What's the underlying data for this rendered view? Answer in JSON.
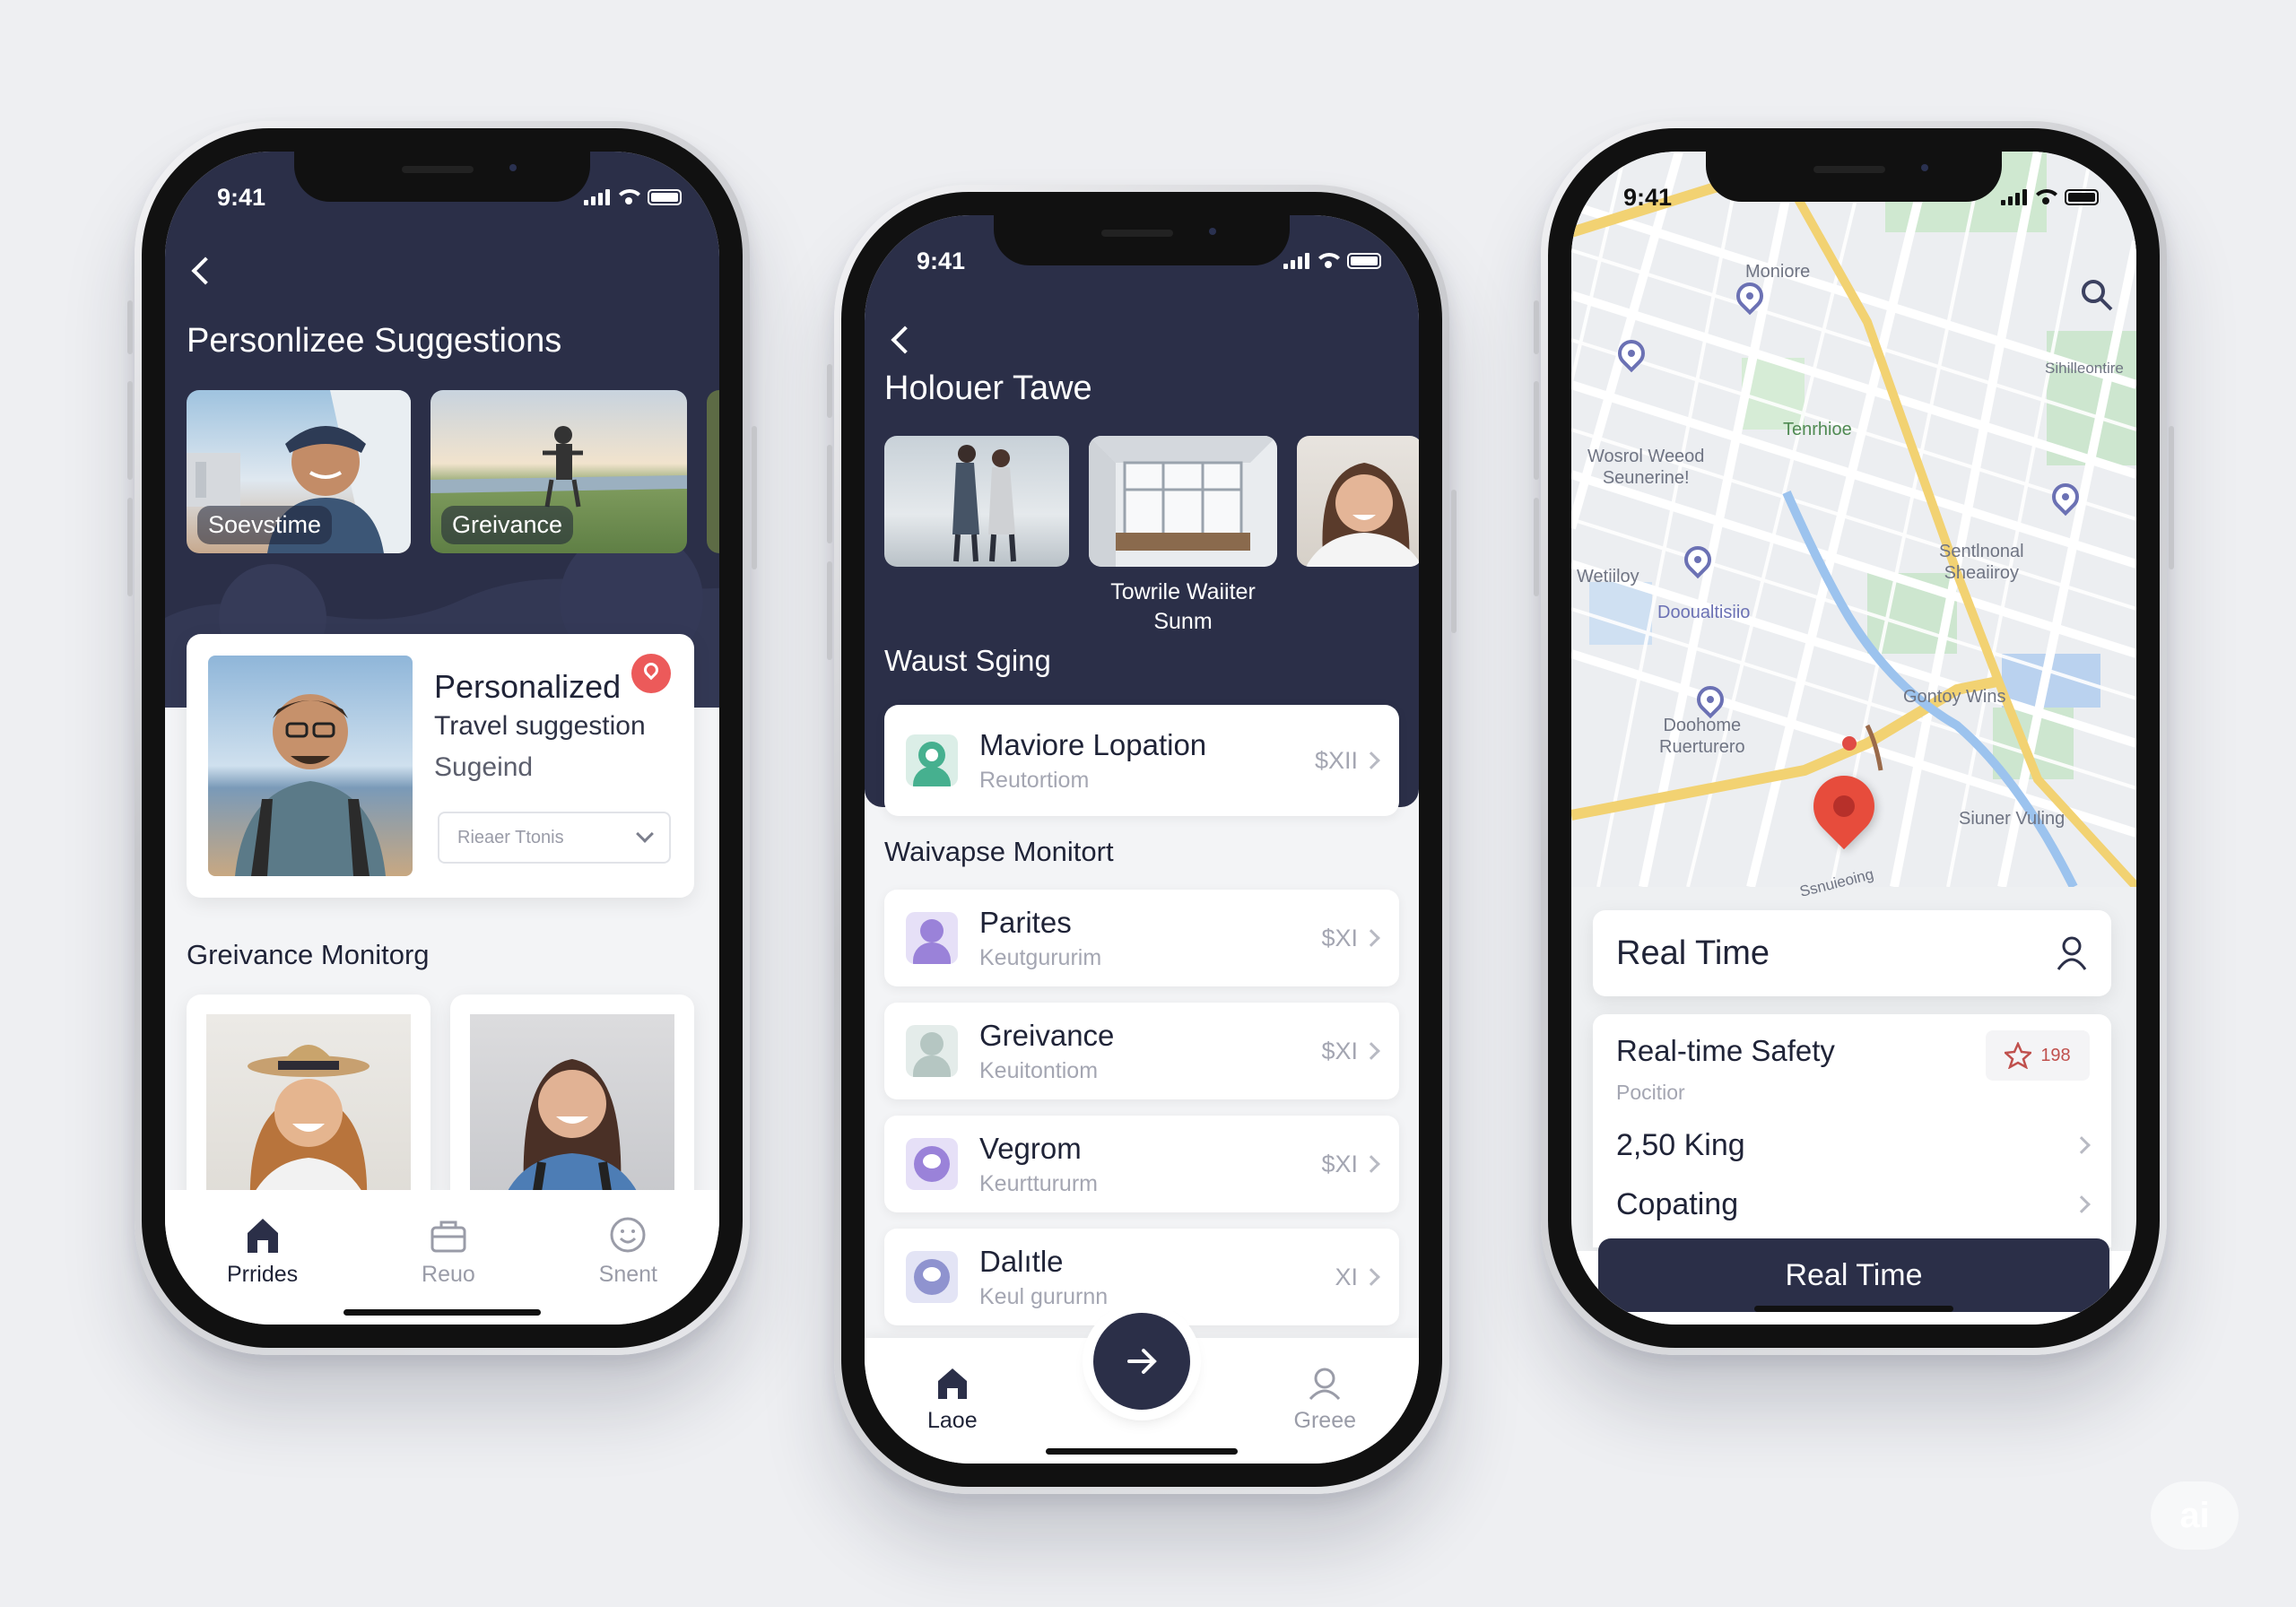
{
  "colors": {
    "navy": "#2b2f48",
    "accent": "#e85a5a",
    "bg": "#eeeff2"
  },
  "phone1": {
    "time": "9:41",
    "title": "Personlizee Suggestions",
    "cards": [
      {
        "label": "Soevstime"
      },
      {
        "label": "Greivance"
      }
    ],
    "feature": {
      "title": "Personalized",
      "line1": "Travel suggestion",
      "line2": "Sugeind",
      "select": "Rieaer Ttonis"
    },
    "section": "Greivance Monitorg",
    "nav": [
      {
        "label": "Prrides",
        "icon": "home-icon"
      },
      {
        "label": "Reuo",
        "icon": "bag-icon"
      },
      {
        "label": "Snent",
        "icon": "smile-icon"
      }
    ]
  },
  "phone2": {
    "time": "9:41",
    "title": "Holouer Tawe",
    "photo_caption": "Towrile Waiiter\nSunm",
    "photo_caption_line1": "Towrile Waiiter",
    "photo_caption_line2": "Sunm",
    "section1": "Waust Sging",
    "featured": {
      "title": "Maviore Lopation",
      "sub": "Reutortiom",
      "price": "$XII"
    },
    "section2": "Waivapse Monitort",
    "rows": [
      {
        "title": "Parites",
        "sub": "Keutgururim",
        "price": "$XI"
      },
      {
        "title": "Greivance",
        "sub": "Keuitontiom",
        "price": "$XI"
      },
      {
        "title": "Vegrom",
        "sub": "Keurttururm",
        "price": "$XI"
      },
      {
        "title": "Dalıtle",
        "sub": "Keul gururnn",
        "price": "XI"
      }
    ],
    "nav": [
      {
        "label": "Laoe",
        "icon": "home-icon"
      },
      {
        "label": "Greee",
        "icon": "user-icon"
      }
    ]
  },
  "phone3": {
    "time": "9:41",
    "map_labels": [
      "Moniore",
      "Tenrhioe",
      "Wosrol Weeod\nSeunerine!",
      "Wetiiloy",
      "Dooualtisiio",
      "Sentlnonal\nSheaiiroy",
      "Gontoy Wins",
      "Doohome\nRuerturero",
      "Siuner Vuling",
      "Ssnuieoing",
      "Sihilleontire"
    ],
    "search_icon": "search-icon",
    "bar_title": "Real Time",
    "safety": {
      "title": "Real-time Safety",
      "sub": "Pocitior",
      "badge": "198",
      "row1": "2,50 King",
      "row2": "Copating"
    },
    "button": "Real Time"
  }
}
